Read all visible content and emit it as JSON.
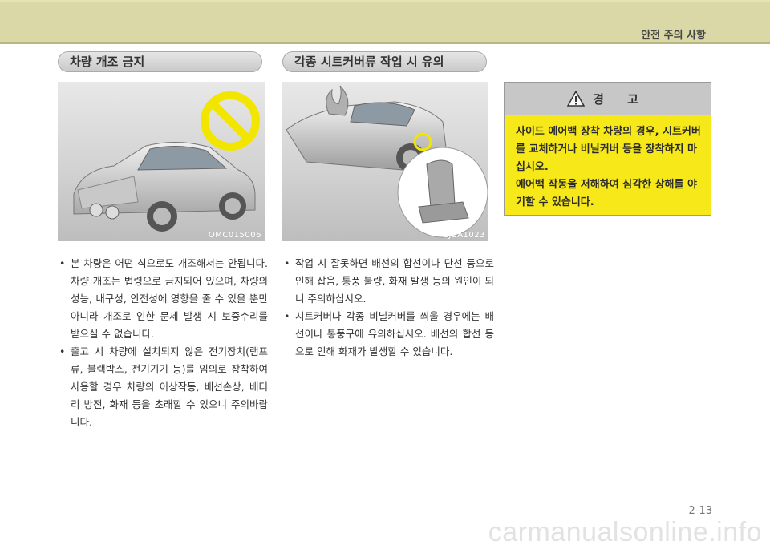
{
  "header": {
    "section": "안전 주의 사항"
  },
  "left": {
    "heading": "차량 개조 금지",
    "image_code": "OMC015006",
    "bullets": [
      "본 차량은 어떤 식으로도 개조해서는 안됩니다. 차량 개조는 법령으로 금지되어 있으며, 차량의 성능, 내구성, 안전성에 영향을 줄 수 있을 뿐만 아니라 개조로 인한 문제 발생 시 보증수리를 받으실 수 없습니다.",
      "출고 시 차량에 설치되지 않은 전기장치(램프류, 블랙박스, 전기기기 등)를 임의로 장착하여 사용할 경우 차량의 이상작동, 배선손상, 배터리 방전, 화재 등을 초래할 수 있으니 주의바랍니다."
    ]
  },
  "middle": {
    "heading": "각종 시트커버류 작업 시 유의",
    "image_code": "1JBA1023",
    "bullets": [
      "작업 시 잘못하면 배선의 합선이나 단선 등으로 인해 잡음, 통풍 불량, 화재 발생 등의 원인이 되니 주의하십시오.",
      "시트커버나 각종 비닐커버를 씌울 경우에는 배선이나 통풍구에 유의하십시오. 배선의 합선 등으로 인해 화재가 발생할 수 있습니다."
    ]
  },
  "warning": {
    "title": "경 고",
    "lines": [
      "사이드 에어백 장착 차량의 경우, 시트커버를 교체하거나 비닐커버 등을 장착하지 마십시오.",
      "에어백 작동을 저해하여 심각한 상해를 야기할 수 있습니다."
    ],
    "icon": "warning-triangle-icon"
  },
  "footer": {
    "page": "2-13",
    "watermark": "carmanualsonline.info"
  }
}
